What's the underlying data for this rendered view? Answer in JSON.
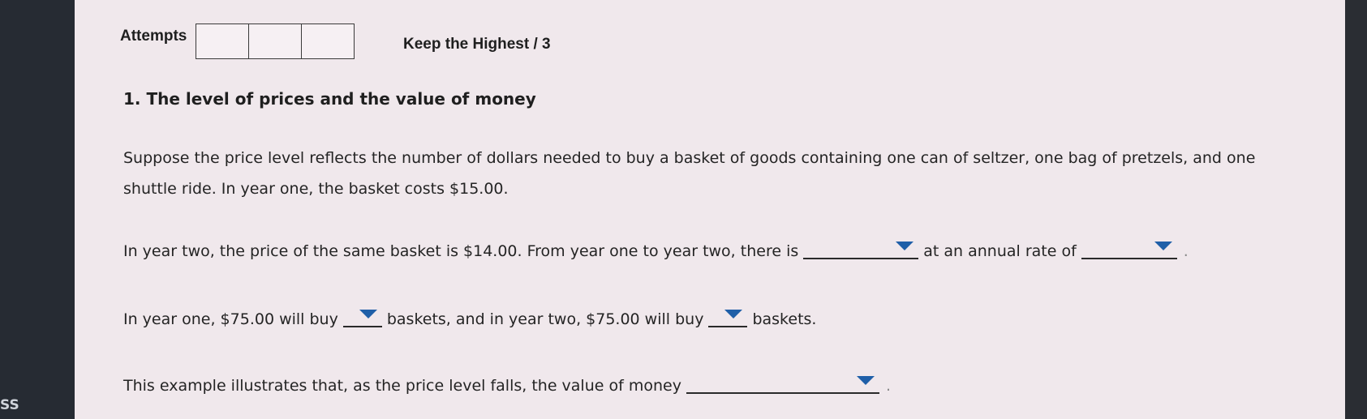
{
  "sidebar": {
    "label": "SS"
  },
  "header": {
    "attempts_label": "Attempts",
    "keep_label": "Keep the Highest / 3"
  },
  "question": {
    "title": "1. The level of prices and the value of money",
    "intro_line1": "Suppose the price level reflects the number of dollars needed to buy a basket of goods containing one can of seltzer, one bag of pretzels, and one",
    "intro_line2": "shuttle ride. In year one, the basket costs $15.00.",
    "p2_a": "In year two, the price of the same basket is $14.00. From year one to year two, there is",
    "p2_b": "at an annual rate of",
    "p3_a": "In year one, $75.00 will buy",
    "p3_b": "baskets, and in year two, $75.00 will buy",
    "p3_c": "baskets.",
    "p4_a": "This example illustrates that, as the price level falls, the value of money",
    "period": "."
  },
  "icons": {
    "dropdown": "dropdown-triangle-icon"
  },
  "colors": {
    "dropdown_arrow": "#1f5fa8",
    "page_bg": "#f0e8ec"
  }
}
